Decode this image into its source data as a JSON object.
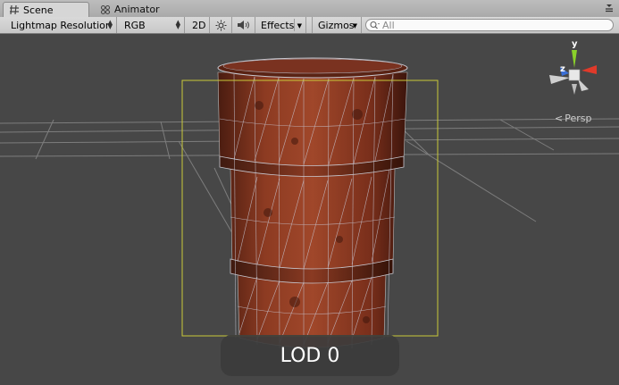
{
  "tabs": {
    "scene_label": "Scene",
    "animator_label": "Animator"
  },
  "toolbar": {
    "draw_mode": "Lightmap Resolution",
    "render_mode": "RGB",
    "mode_2d": "2D",
    "effects": "Effects",
    "gizmos": "Gizmos",
    "search_placeholder": "All"
  },
  "viewport": {
    "axis_y": "y",
    "axis_z": "z",
    "projection": "Persp",
    "lod_label": "LOD 0"
  },
  "colors": {
    "viewport_bg": "#474747",
    "selection_box": "#c9c93a",
    "barrel_base": "#8a3a22",
    "axis_x": "#e03a2a",
    "axis_y": "#8ad12a",
    "axis_z": "#3a6fd6"
  },
  "icons": [
    "scene-hash-icon",
    "animator-icon",
    "tab-menu-icon",
    "sun-icon",
    "speaker-icon",
    "search-icon",
    "chevron-left-icon"
  ]
}
